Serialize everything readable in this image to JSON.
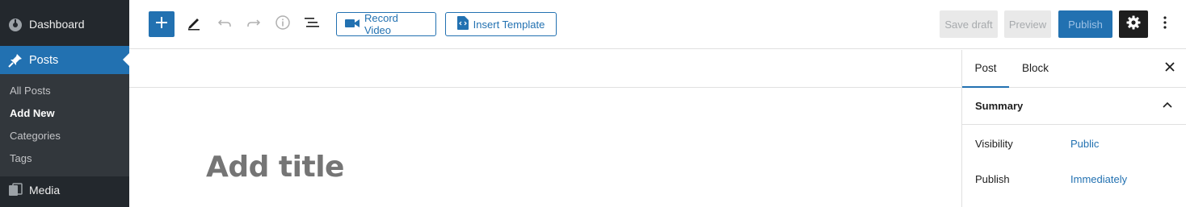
{
  "admin_menu": {
    "dashboard": "Dashboard",
    "posts": "Posts",
    "submenu": [
      "All Posts",
      "Add New",
      "Categories",
      "Tags"
    ],
    "media": "Media"
  },
  "toolbar": {
    "add_block_icon": "plus-icon",
    "tools": [
      "pencil-icon",
      "undo-icon",
      "redo-icon",
      "info-icon",
      "list-view-icon"
    ],
    "record_video": "Record Video",
    "insert_template": "Insert Template",
    "save_draft": "Save draft",
    "preview": "Preview",
    "publish": "Publish"
  },
  "editor": {
    "title_placeholder": "Add title"
  },
  "settings_panel": {
    "tab_post": "Post",
    "tab_block": "Block",
    "summary_title": "Summary",
    "visibility_label": "Visibility",
    "visibility_value": "Public",
    "publish_label": "Publish",
    "publish_value": "Immediately"
  },
  "colors": {
    "admin_bg": "#23282d",
    "admin_active": "#2271b1",
    "accent": "#2271b1"
  }
}
